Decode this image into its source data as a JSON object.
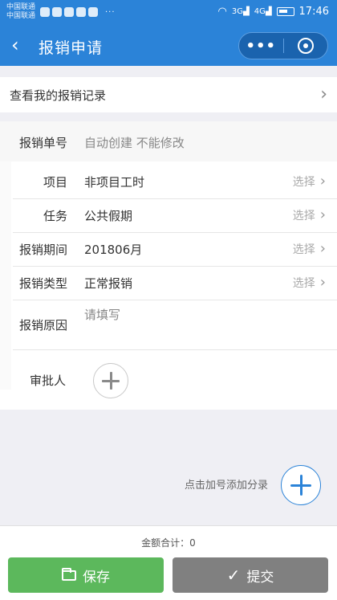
{
  "status_bar": {
    "carrier_1": "中国联通",
    "carrier_2": "中国联通",
    "signal_1": "3G",
    "signal_2": "4G",
    "time": "17:46"
  },
  "nav": {
    "title": "报销申请"
  },
  "records_link": {
    "label": "查看我的报销记录"
  },
  "form": {
    "number": {
      "label": "报销单号",
      "value": "自动创建 不能修改"
    },
    "project": {
      "label": "项目",
      "value": "非项目工时",
      "picker": "选择"
    },
    "task": {
      "label": "任务",
      "value": "公共假期",
      "picker": "选择"
    },
    "period": {
      "label": "报销期间",
      "value": "201806月",
      "picker": "选择"
    },
    "type": {
      "label": "报销类型",
      "value": "正常报销",
      "picker": "选择"
    },
    "reason": {
      "label": "报销原因",
      "placeholder": "请填写"
    },
    "approver": {
      "label": "审批人"
    }
  },
  "add_category": {
    "hint": "点击加号添加分录"
  },
  "footer": {
    "total": "金额合计：0",
    "save_label": "保存",
    "submit_label": "提交"
  },
  "colors": {
    "primary": "#2b83d8",
    "save": "#5cb85c",
    "submit": "#808080"
  }
}
